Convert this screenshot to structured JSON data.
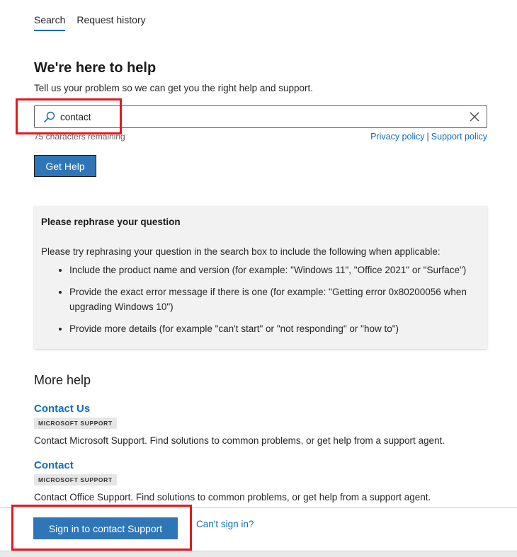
{
  "tabs": [
    {
      "label": "Search",
      "active": true
    },
    {
      "label": "Request history",
      "active": false
    }
  ],
  "header": {
    "title": "We're here to help",
    "subtitle": "Tell us your problem so we can get you the right help and support."
  },
  "search": {
    "value": "contact",
    "chars_remaining": "75 characters remaining",
    "privacy_link": "Privacy policy",
    "separator": "|",
    "support_link": "Support policy",
    "button_label": "Get Help"
  },
  "rephrase": {
    "title": "Please rephrase your question",
    "intro": "Please try rephrasing your question in the search box to include the following when applicable:",
    "items": [
      "Include the product name and version (for example: \"Windows 11\", \"Office 2021\" or \"Surface\")",
      "Provide the exact error message if there is one (for example: \"Getting error 0x80200056 when upgrading Windows 10\")",
      "Provide more details (for example \"can't start\" or \"not responding\" or \"how to\")"
    ]
  },
  "more_help": {
    "title": "More help",
    "results": [
      {
        "title": "Contact Us",
        "tag": "MICROSOFT SUPPORT",
        "description": "Contact Microsoft Support. Find solutions to common problems, or get help from a support agent."
      },
      {
        "title": "Contact",
        "tag": "MICROSOFT SUPPORT",
        "description": "Contact Office Support. Find solutions to common problems, or get help from a support agent."
      }
    ]
  },
  "footer": {
    "signin_label": "Sign in to contact Support",
    "cant_signin": "Can't sign in?"
  },
  "colors": {
    "accent": "#0f6cbd",
    "button": "#2f76b8",
    "highlight": "#e0191f",
    "panel": "#f2f2f2"
  },
  "icons": {
    "search": "search-icon",
    "clear": "close-icon"
  }
}
